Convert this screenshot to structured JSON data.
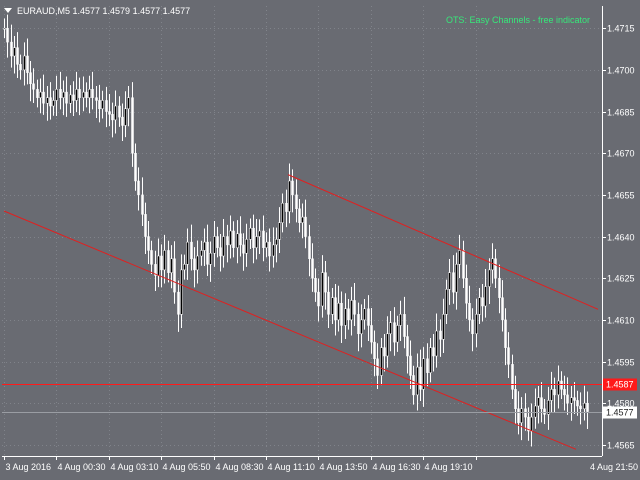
{
  "header": {
    "symbol_text": "EURAUD,M5  1.4577 1.4579 1.4577 1.4577",
    "indicator_text": "OTS: Easy Channels - free indicator"
  },
  "colors": {
    "background": "#696b72",
    "grid": "#80838a",
    "candle": "#ffffff",
    "frame": "#ffffff",
    "channel": "#e02020",
    "level_line": "#ff1a1a",
    "level_tag_bg": "#ff1a1a",
    "bid_tag_bg": "#ffffff",
    "indicator_text": "#37e87a"
  },
  "chart_data": {
    "type": "candlestick",
    "symbol": "EURAUD",
    "timeframe": "M5",
    "ylim": [
      1.4561,
      1.4723
    ],
    "price_ticks": [
      "1.4715",
      "1.4700",
      "1.4685",
      "1.4670",
      "1.4655",
      "1.4640",
      "1.4625",
      "1.4610",
      "1.4595",
      "1.4580",
      "1.4565"
    ],
    "time_ticks": [
      "3 Aug 2016",
      "4 Aug 00:30",
      "4 Aug 03:10",
      "4 Aug 05:50",
      "4 Aug 08:30",
      "4 Aug 11:10",
      "4 Aug 13:50",
      "4 Aug 16:30",
      "4 Aug 19:10",
      "4 Aug 21:50"
    ],
    "grid": true,
    "horizontal_level": {
      "price": 1.4587,
      "label": "1.4587"
    },
    "bid": {
      "price": 1.4577,
      "label": "1.4577"
    },
    "channel": {
      "upper": [
        {
          "bar": 0,
          "price": 1.46623
        },
        {
          "bar": 1,
          "price": 1.46138
        }
      ],
      "lower": [
        {
          "bar": 2,
          "price": 1.46492
        },
        {
          "bar": 3,
          "price": 1.45634
        }
      ]
    },
    "closes": [
      1.4715,
      1.471,
      1.4705,
      1.4708,
      1.4702,
      1.47,
      1.4705,
      1.4699,
      1.4695,
      1.4693,
      1.469,
      1.4692,
      1.4688,
      1.469,
      1.4687,
      1.4689,
      1.4693,
      1.469,
      1.4692,
      1.4688,
      1.4691,
      1.4689,
      1.4693,
      1.469,
      1.4692,
      1.469,
      1.4693,
      1.469,
      1.4689,
      1.4686,
      1.4689,
      1.4685,
      1.4684,
      1.4682,
      1.4687,
      1.4683,
      1.468,
      1.4686,
      1.469,
      1.467,
      1.466,
      1.4655,
      1.4648,
      1.464,
      1.4635,
      1.463,
      1.4626,
      1.4633,
      1.4628,
      1.4635,
      1.4627,
      1.4632,
      1.462,
      1.4612,
      1.4628,
      1.463,
      1.4638,
      1.4632,
      1.4628,
      1.4633,
      1.4635,
      1.4638,
      1.463,
      1.4634,
      1.464,
      1.4636,
      1.4633,
      1.464,
      1.4637,
      1.4642,
      1.4636,
      1.4641,
      1.4637,
      1.4634,
      1.4639,
      1.4643,
      1.4636,
      1.464,
      1.4642,
      1.4636,
      1.4638,
      1.4633,
      1.4637,
      1.4639,
      1.4645,
      1.4652,
      1.4649,
      1.466,
      1.4655,
      1.465,
      1.4645,
      1.4647,
      1.464,
      1.4632,
      1.4625,
      1.462,
      1.4615,
      1.4627,
      1.462,
      1.4612,
      1.4618,
      1.461,
      1.4616,
      1.4608,
      1.4614,
      1.461,
      1.4617,
      1.4612,
      1.4605,
      1.461,
      1.4614,
      1.4608,
      1.4602,
      1.4596,
      1.459,
      1.46,
      1.4597,
      1.4605,
      1.4609,
      1.4602,
      1.4608,
      1.4612,
      1.4604,
      1.4597,
      1.459,
      1.4583,
      1.4593,
      1.4585,
      1.4596,
      1.4591,
      1.46,
      1.4597,
      1.4606,
      1.4603,
      1.4612,
      1.4621,
      1.4627,
      1.462,
      1.463,
      1.4635,
      1.4625,
      1.4616,
      1.461,
      1.4605,
      1.4612,
      1.4618,
      1.4615,
      1.4622,
      1.4628,
      1.4632,
      1.4625,
      1.4618,
      1.461,
      1.46,
      1.4594,
      1.4585,
      1.4578,
      1.4573,
      1.4578,
      1.4575,
      1.457,
      1.4575,
      1.4579,
      1.4582,
      1.4578,
      1.4576,
      1.4581,
      1.4585,
      1.4583,
      1.4588,
      1.4585,
      1.4583,
      1.458,
      1.4582,
      1.4581,
      1.4579,
      1.4578,
      1.458,
      1.4577
    ]
  }
}
